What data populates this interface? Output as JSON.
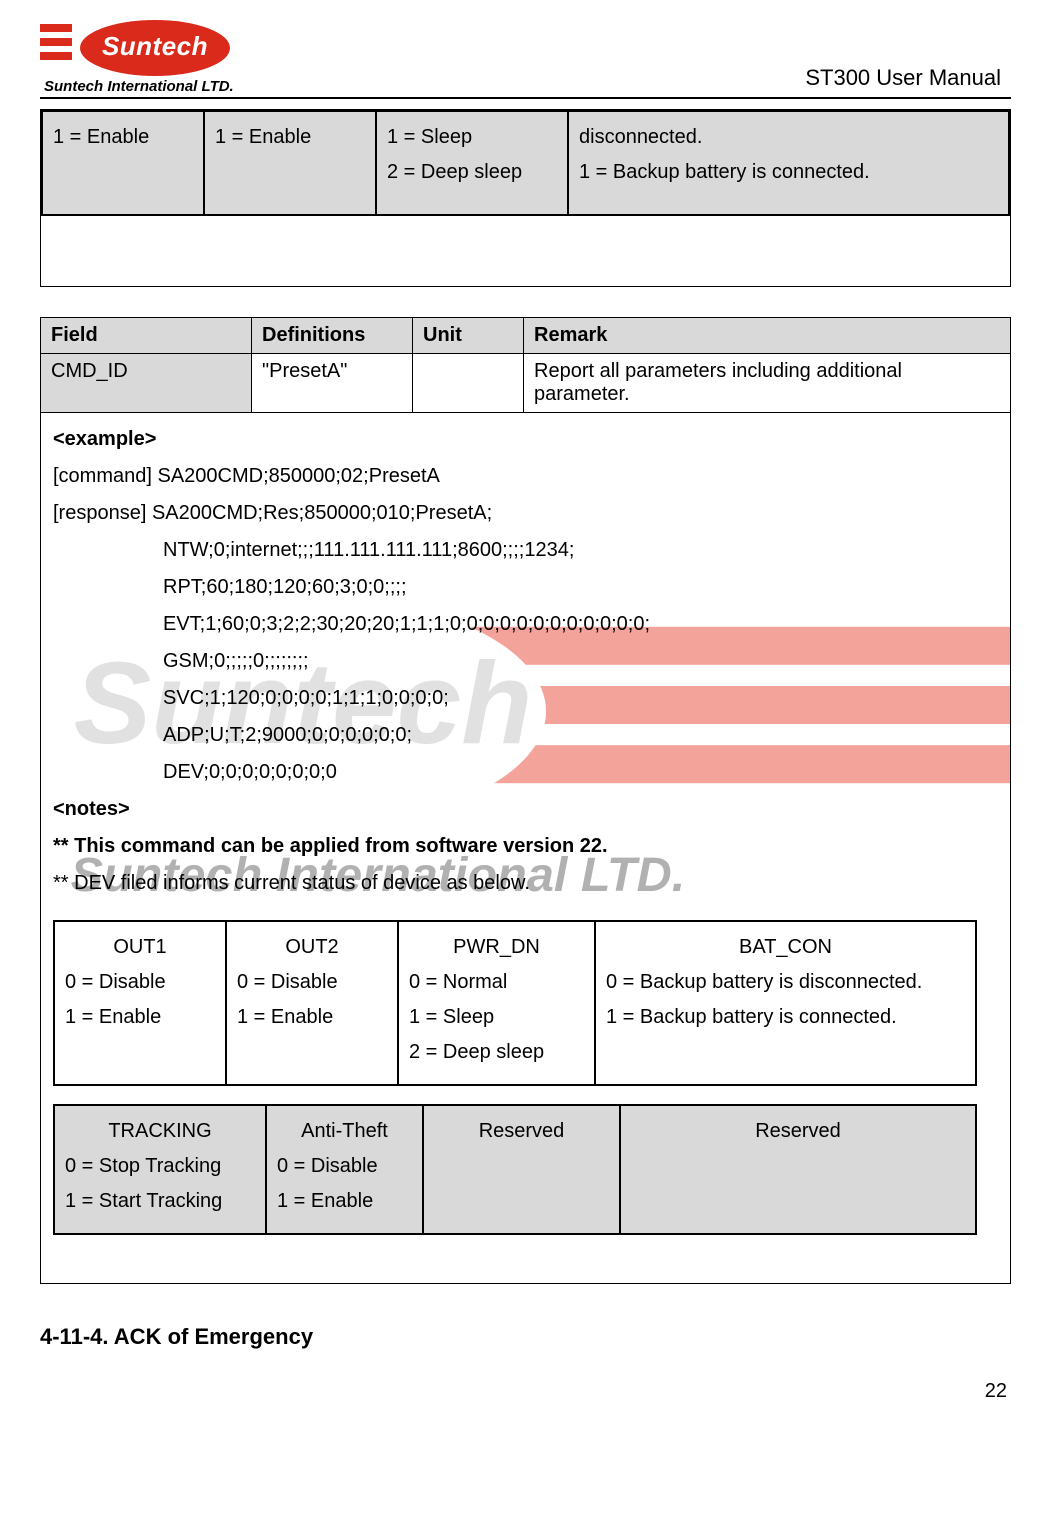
{
  "header": {
    "brand": "Suntech",
    "sub": "Suntech International LTD.",
    "doc_title": "ST300 User Manual"
  },
  "top_status": {
    "c1": "1 = Enable",
    "c2": "1 = Enable",
    "c3_l1": "1 = Sleep",
    "c3_l2": "2 = Deep sleep",
    "c4_l1": "disconnected.",
    "c4_l2": "1 = Backup battery is connected."
  },
  "param_header": {
    "field": "Field",
    "def": "Definitions",
    "unit": "Unit",
    "remark": "Remark"
  },
  "param_row": {
    "field": "CMD_ID",
    "def": "\"PresetA\"",
    "unit": "",
    "remark": "Report all parameters including additional parameter."
  },
  "example": {
    "title": "<example>",
    "cmd": "[command] SA200CMD;850000;02;PresetA",
    "resp": "[response] SA200CMD;Res;850000;010;PresetA;",
    "lines": [
      "NTW;0;internet;;;111.111.111.111;8600;;;;1234;",
      "RPT;60;180;120;60;3;0;0;;;;",
      "EVT;1;60;0;3;2;2;30;20;20;1;1;1;0;0;0;0;0;0;0;0;0;0;0;0;",
      "GSM;0;;;;;0;;;;;;;;",
      "SVC;1;120;0;0;0;0;1;1;1;0;0;0;0;",
      "ADP;U;T;2;9000;0;0;0;0;0;0;",
      "DEV;0;0;0;0;0;0;0;0"
    ],
    "notes_title": "<notes>",
    "note1": "** This command can be applied from software version 22.",
    "note2": "** DEV filed informs current status of device as below."
  },
  "status_a": {
    "out1_t": "OUT1",
    "out1_l1": "0 = Disable",
    "out1_l2": "1 = Enable",
    "out2_t": "OUT2",
    "out2_l1": "0 = Disable",
    "out2_l2": "1 = Enable",
    "pwr_t": "PWR_DN",
    "pwr_l1": "0 = Normal",
    "pwr_l2": "1 = Sleep",
    "pwr_l3": "2 = Deep sleep",
    "bat_t": "BAT_CON",
    "bat_l1": "0 = Backup battery is disconnected.",
    "bat_l2": "1 = Backup battery is connected."
  },
  "status_b": {
    "trk_t": "TRACKING",
    "trk_l1": "0 = Stop Tracking",
    "trk_l2": "1 = Start Tracking",
    "at_t": "Anti-Theft",
    "at_l1": "0 = Disable",
    "at_l2": "1 = Enable",
    "r1": "Reserved",
    "r2": "Reserved"
  },
  "section": "4-11-4. ACK of Emergency",
  "page_number": "22"
}
